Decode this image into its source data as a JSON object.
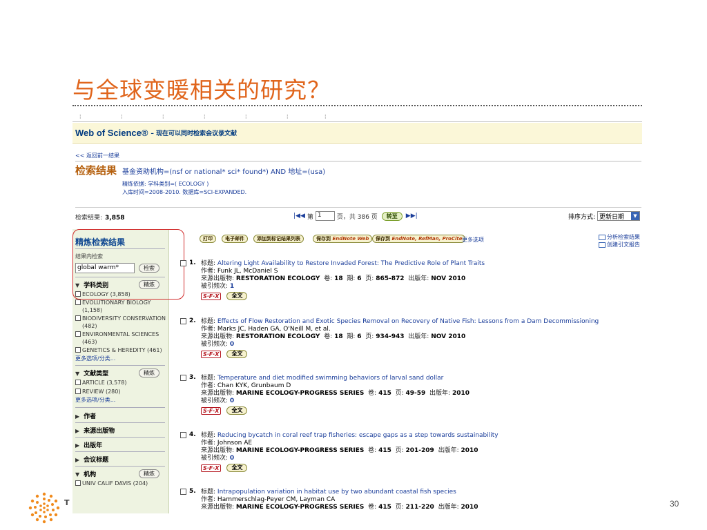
{
  "slide": {
    "title": "与全球变暖相关的研究？",
    "page_number": "30",
    "partial_letter": "T"
  },
  "wos": {
    "brand": "Web of Science®",
    "subtitle": "– 现在可以同时检索会议录文献",
    "back_link": "<< 返回前一结果",
    "results_title": "检索结果",
    "query": "基金资助机构=(nsf or national* sci* found*) AND 地址=(usa)",
    "refine_basis": "精炼依据: 学科类别=( ECOLOGY )",
    "timespan": "入库时间=2008-2010. 数据库=SCI-EXPANDED.",
    "count_label": "检索结果:",
    "count_value": "3,858",
    "pager": {
      "prefix": "第",
      "page_value": "1",
      "suffix": "页，共 386 页",
      "go_label": "转至"
    },
    "sort": {
      "label": "排序方式:",
      "value": "更新日期"
    }
  },
  "sidebar": {
    "title": "精炼检索结果",
    "within_label": "结果内检索",
    "search_value": "global warm*",
    "search_btn": "检索",
    "refine_btn": "精炼",
    "sections": {
      "subject": {
        "label": "学科类别",
        "items": [
          "ECOLOGY (3,858)",
          "EVOLUTIONARY BIOLOGY (1,158)",
          "BIODIVERSITY CONSERVATION (482)",
          "ENVIRONMENTAL SCIENCES (463)",
          "GENETICS & HEREDITY (461)"
        ],
        "more": "更多选项/分类..."
      },
      "doctype": {
        "label": "文献类型",
        "items": [
          "ARTICLE (3,578)",
          "REVIEW (280)"
        ],
        "more": "更多选项/分类..."
      },
      "author": "作者",
      "source": "来源出版物",
      "year": "出版年",
      "conference": "会议标题",
      "org": {
        "label": "机构",
        "items": [
          "UNIV CALIF DAVIS (204)"
        ]
      }
    }
  },
  "toolbar": {
    "print": "打印",
    "email": "电子邮件",
    "add_marked": "添加到标记结果列表",
    "save_en_prefix": "保存到",
    "save_en_brand": "EndNote Web",
    "save_rm_prefix": "保存到",
    "save_rm_brand": "EndNote, RefMan, ProCite",
    "more": "更多选项",
    "analyze": "分析检索结果",
    "citation_report": "创建引文报告"
  },
  "labels": {
    "title": "标题:",
    "author": "作者:",
    "source": "来源出版物:",
    "volume": "卷:",
    "issue": "期:",
    "pages": "页:",
    "year": "出版年:",
    "cited": "被引频次:",
    "sfx": "S·F·X",
    "fulltext": "全文"
  },
  "records": [
    {
      "num": "1.",
      "title": "Altering Light Availability to Restore Invaded Forest: The Predictive Role of Plant Traits",
      "authors": "Funk JL, McDaniel S",
      "source": "RESTORATION ECOLOGY",
      "volume": "18",
      "issue": "6",
      "pages": "865-872",
      "year": "NOV 2010",
      "cited": "1"
    },
    {
      "num": "2.",
      "title": "Effects of Flow Restoration and Exotic Species Removal on Recovery of Native Fish: Lessons from a Dam Decommissioning",
      "authors": "Marks JC, Haden GA, O'Neill M, et al.",
      "source": "RESTORATION ECOLOGY",
      "volume": "18",
      "issue": "6",
      "pages": "934-943",
      "year": "NOV 2010",
      "cited": "0"
    },
    {
      "num": "3.",
      "title": "Temperature and diet modified swimming behaviors of larval sand dollar",
      "authors": "Chan KYK, Grunbaum D",
      "source": "MARINE ECOLOGY-PROGRESS SERIES",
      "volume": "415",
      "pages": "49-59",
      "year": "2010",
      "cited": "0"
    },
    {
      "num": "4.",
      "title": "Reducing bycatch in coral reef trap fisheries: escape gaps as a step towards sustainability",
      "authors": "Johnson AE",
      "source": "MARINE ECOLOGY-PROGRESS SERIES",
      "volume": "415",
      "pages": "201-209",
      "year": "2010",
      "cited": "0"
    },
    {
      "num": "5.",
      "title": "Intrapopulation variation in habitat use by two abundant coastal fish species",
      "authors": "Hammerschlag-Peyer CM, Layman CA",
      "source": "MARINE ECOLOGY-PROGRESS SERIES",
      "volume": "415",
      "pages": "211-220",
      "year": "2010"
    }
  ],
  "colors": {
    "title_orange": "#e0651c",
    "link_blue": "#1a3d9a",
    "sidebar_green": "#eef3e1",
    "highlight_red": "#d12a2a"
  }
}
